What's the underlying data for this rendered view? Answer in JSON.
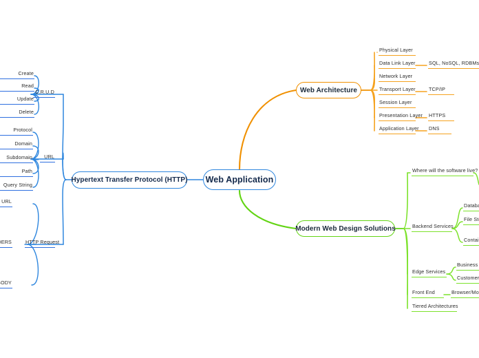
{
  "diagram": {
    "type": "mind-map",
    "root": {
      "label": "Web Application"
    },
    "colors": {
      "blue": "#2E86DE",
      "blue_leaf": "#2E6FE0",
      "orange": "#F09000",
      "orange_leaf": "#F5A21E",
      "green": "#62D413",
      "green_leaf": "#7CE22B",
      "text": "#2b2b2b",
      "root_text": "#13294B",
      "background": "#ffffff"
    },
    "branches": {
      "http": {
        "label": "Hypertext Transfer Protocol (HTTP)",
        "side": "left",
        "color": "blue",
        "children": [
          {
            "label": "C.R.U.D",
            "children": [
              {
                "label": "Create"
              },
              {
                "label": "Read"
              },
              {
                "label": "Update"
              },
              {
                "label": "Delete"
              }
            ]
          },
          {
            "label": "URL",
            "children": [
              {
                "label": "Protocol"
              },
              {
                "label": "Domain"
              },
              {
                "label": "Subdomain"
              },
              {
                "label": "Path"
              },
              {
                "label": "Query String"
              }
            ]
          },
          {
            "label": "HTTP Request",
            "children": [
              {
                "label": "URL"
              },
              {
                "label": "HEADERS"
              },
              {
                "label": "BODY"
              }
            ]
          }
        ]
      },
      "architecture": {
        "label": "Web Architecture",
        "side": "right",
        "color": "orange",
        "children": [
          {
            "label": "Physical Layer",
            "children": []
          },
          {
            "label": "Data Link Layer",
            "children": [
              {
                "label": "SQL, NoSQL, RDBMs"
              }
            ]
          },
          {
            "label": "Network Layer",
            "children": []
          },
          {
            "label": "Transport Layer",
            "children": [
              {
                "label": "TCP/IP"
              }
            ]
          },
          {
            "label": "Session Layer",
            "children": []
          },
          {
            "label": "Presentation Layer",
            "children": [
              {
                "label": "HTTPS"
              }
            ]
          },
          {
            "label": "Application Layer",
            "children": [
              {
                "label": "DNS"
              }
            ]
          }
        ]
      },
      "modern": {
        "label": "Modern Web Design Solutions",
        "side": "right",
        "color": "green",
        "children": [
          {
            "label": "Where will the software live?",
            "children": []
          },
          {
            "label": "Backend Services",
            "children": [
              {
                "label": "Database"
              },
              {
                "label": "File Storage"
              },
              {
                "label": "Containers"
              }
            ]
          },
          {
            "label": "Edge Services",
            "children": [
              {
                "label": "Business Logic"
              },
              {
                "label": "Customer"
              }
            ]
          },
          {
            "label": "Front End",
            "children": [
              {
                "label": "Browser/Mobile"
              }
            ]
          },
          {
            "label": "Tiered Architectures",
            "children": []
          }
        ]
      }
    }
  }
}
